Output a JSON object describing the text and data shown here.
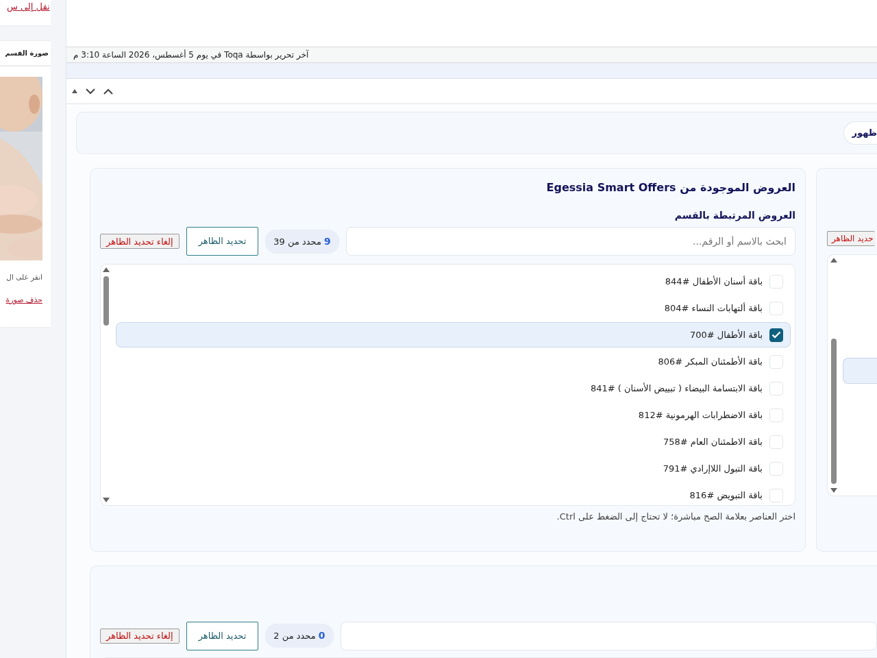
{
  "sidebar": {
    "move_link": "نقل إلى س",
    "image_title": "صورة القسم",
    "hint": "انقر على ال",
    "delete_link": "حذف صورة"
  },
  "status_bar": "آخر تحرير بواسطة Toqa في يوم 5 أغسطس، 2026 الساعة 3:10 م",
  "visibility_pill": "ظهور",
  "offers_card": {
    "title": "العروض الموجودة من Egessia Smart Offers",
    "subtitle": "العروض المرتبطة بالقسم",
    "search": {
      "placeholder": "ابحث بالاسم أو الرقم..."
    },
    "counter": {
      "count": "9",
      "text": "محدد من 39"
    },
    "select_button": "تحديد الظاهر",
    "deselect_button": "إلغاء تحديد الظاهر",
    "items": [
      {
        "label": "باقة أسنان الأطفال #844",
        "checked": false
      },
      {
        "label": "باقة ألتهابات النساء #804",
        "checked": false
      },
      {
        "label": "باقة الأطفال #700",
        "checked": true
      },
      {
        "label": "باقة الأطمئنان المبكر #806",
        "checked": false
      },
      {
        "label": "باقة الابتسامة البيضاء ( تبييض الأسنان ) #841",
        "checked": false
      },
      {
        "label": "باقة الاضطرابات الهرمونية #812",
        "checked": false
      },
      {
        "label": "باقة الاطمئنان العام #758",
        "checked": false
      },
      {
        "label": "باقة التبول اللاإرادي #791",
        "checked": false
      },
      {
        "label": "باقة التبويض #816",
        "checked": false
      }
    ],
    "help": "اختر العناصر بعلامة الصح مباشرة؛ لا تحتاج إلى الضغط على Ctrl."
  },
  "side_card": {
    "deselect_button": "حديد الظاهر"
  },
  "second_card": {
    "counter": {
      "count": "0",
      "text": "محدد من 2"
    },
    "select_button": "تحديد الظاهر",
    "deselect_button": "إلغاء تحديد الظاهر"
  }
}
